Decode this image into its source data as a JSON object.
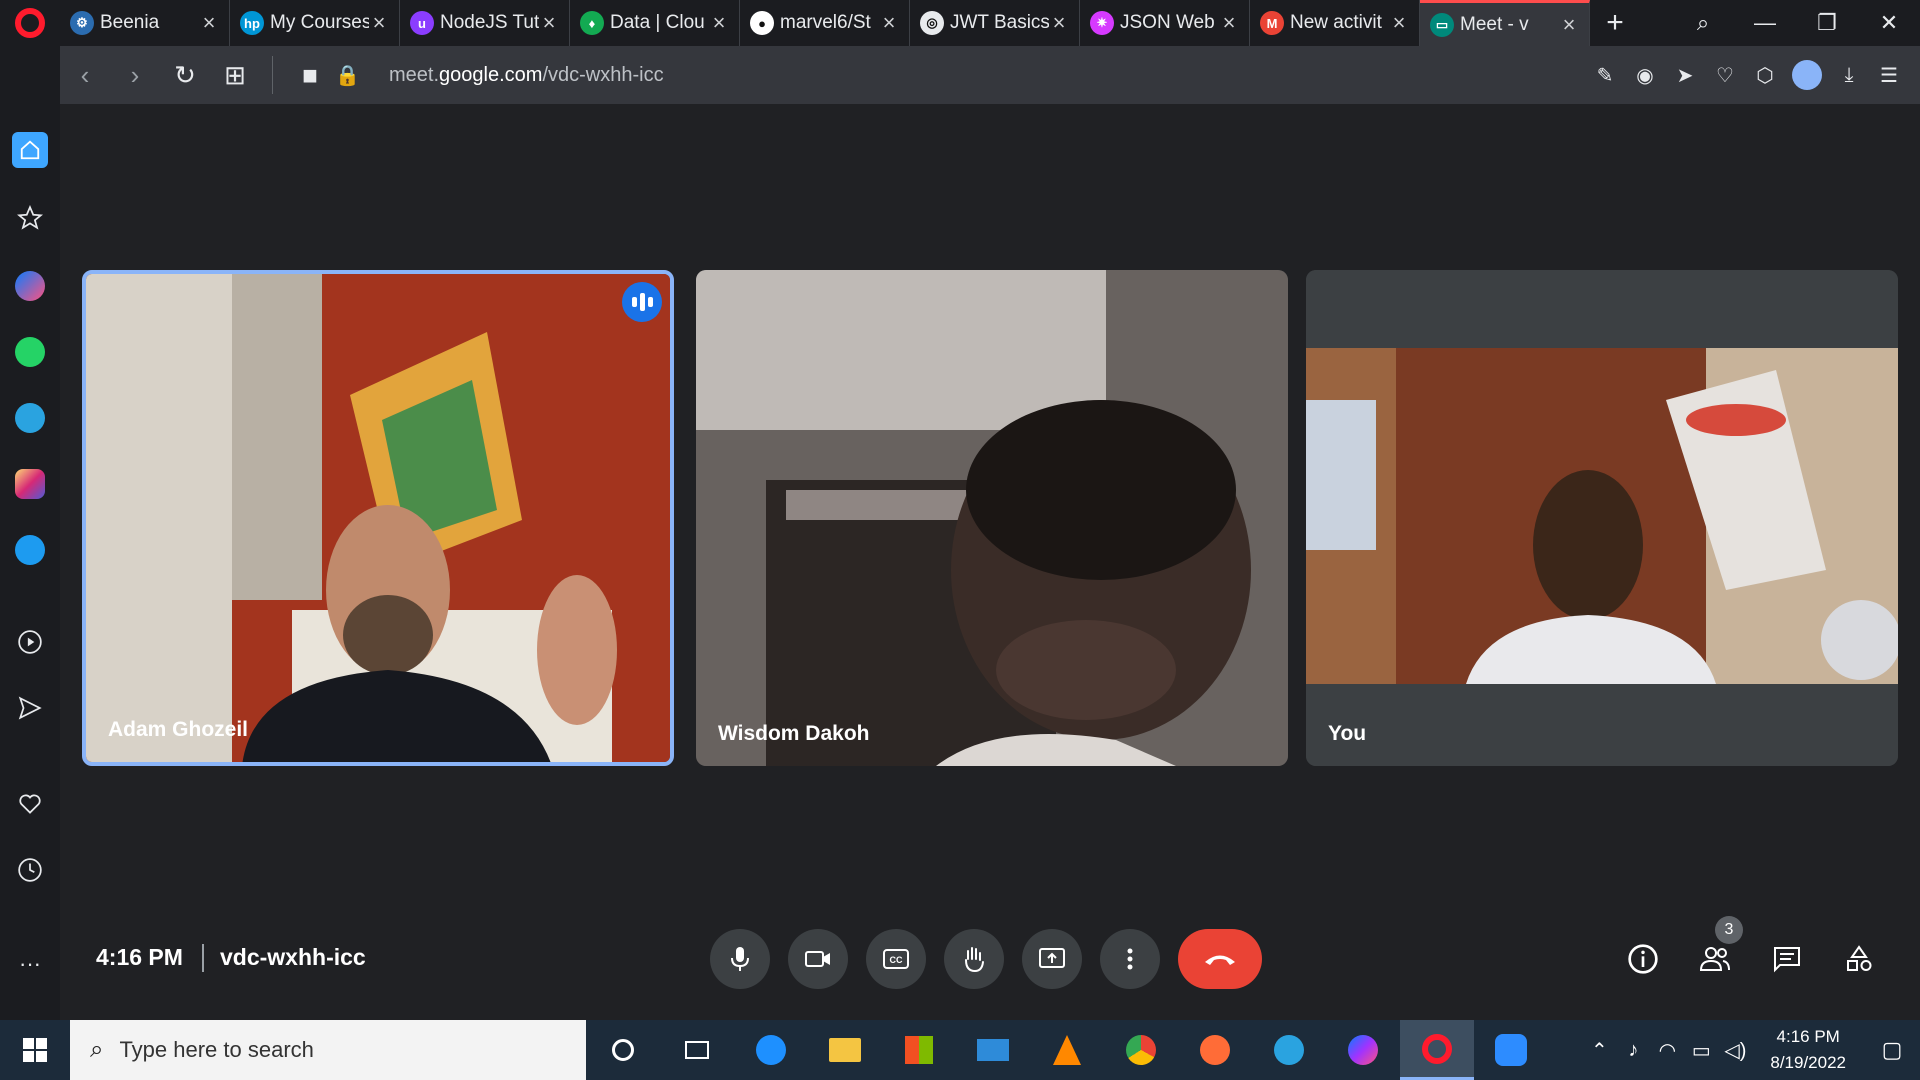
{
  "browser": {
    "tabs": [
      {
        "title": "Beenia",
        "fav": "#2b6cb0",
        "glyph": "⚙",
        "active": false
      },
      {
        "title": "My Courses",
        "fav": "#0096d6",
        "glyph": "hp",
        "active": false
      },
      {
        "title": "NodeJS Tut",
        "fav": "#8b3dff",
        "glyph": "u",
        "active": false
      },
      {
        "title": "Data | Clou",
        "fav": "#13aa52",
        "glyph": "♦",
        "active": false
      },
      {
        "title": "marvel6/St",
        "fav": "#ffffff",
        "glyph": "●",
        "active": false
      },
      {
        "title": "JWT Basics",
        "fav": "#e8eaed",
        "glyph": "◎",
        "active": false
      },
      {
        "title": "JSON Web",
        "fav": "#d63aff",
        "glyph": "✷",
        "active": false
      },
      {
        "title": "New activit",
        "fav": "#ea4335",
        "glyph": "M",
        "active": false
      },
      {
        "title": "Meet - v",
        "fav": "#00897b",
        "glyph": "▭",
        "active": true
      }
    ],
    "new_tab": "+",
    "url_prefix": "meet.",
    "url_domain": "google.com",
    "url_path": "/vdc-wxhh-icc"
  },
  "meeting": {
    "participants": [
      {
        "name": "Adam Ghozeil",
        "speaking": true
      },
      {
        "name": "Wisdom Dakoh",
        "speaking": false
      },
      {
        "name": "You",
        "speaking": false
      }
    ],
    "time": "4:16 PM",
    "code": "vdc-wxhh-icc",
    "participant_count": "3"
  },
  "taskbar": {
    "search_placeholder": "Type here to search",
    "clock_time": "4:16 PM",
    "clock_date": "8/19/2022"
  },
  "colors": {
    "accent": "#8ab4f8",
    "end_call": "#ea4335",
    "speaking": "#1a73e8"
  }
}
